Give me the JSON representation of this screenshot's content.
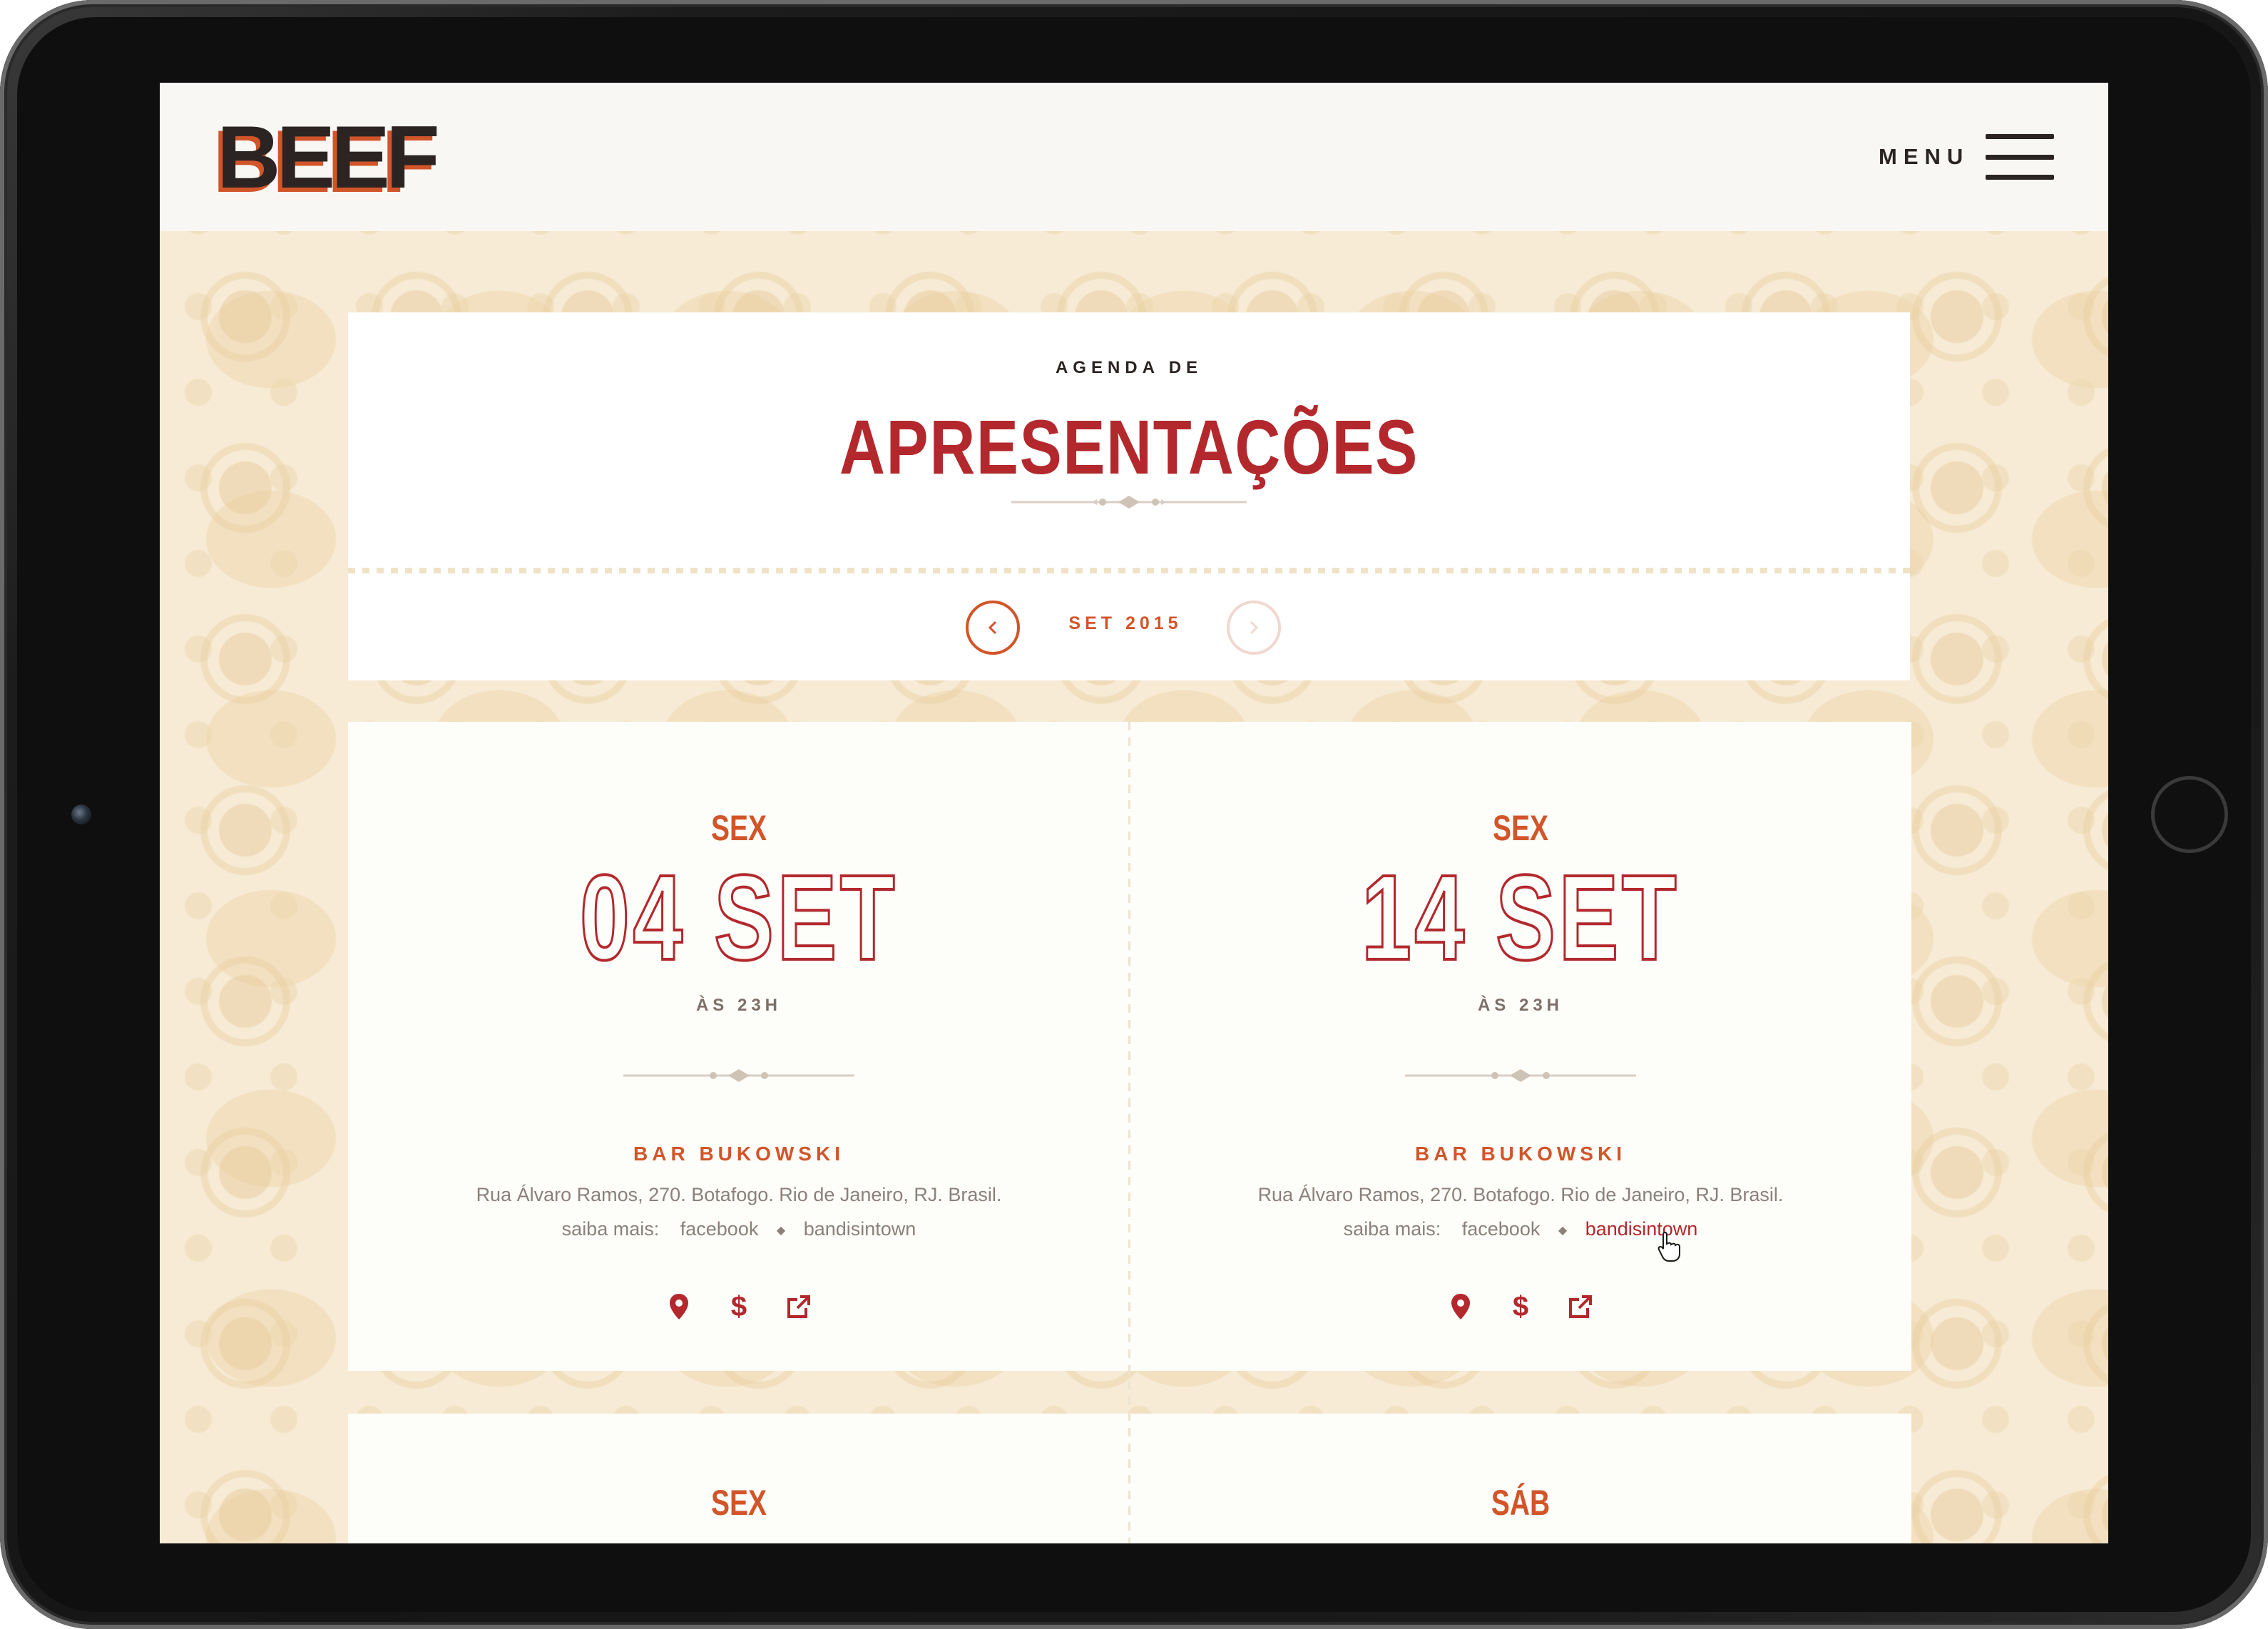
{
  "header": {
    "logo": "BEEF",
    "menu_label": "MENU"
  },
  "title": {
    "small": "AGENDA DE",
    "big": "APRESENTAÇÕES"
  },
  "month_nav": {
    "label": "SET 2015"
  },
  "events": [
    {
      "day": "SEX",
      "date": "04 SET",
      "time": "ÀS 23H",
      "venue": "BAR BUKOWSKI",
      "address": "Rua Álvaro Ramos, 270. Botafogo. Rio de Janeiro, RJ. Brasil.",
      "links_label": "saiba mais:",
      "link_facebook": "facebook",
      "link_bandsintown": "bandisintown"
    },
    {
      "day": "SEX",
      "date": "14 SET",
      "time": "ÀS 23H",
      "venue": "BAR BUKOWSKI",
      "address": "Rua Álvaro Ramos, 270. Botafogo. Rio de Janeiro, RJ. Brasil.",
      "links_label": "saiba mais:",
      "link_facebook": "facebook",
      "link_bandsintown": "bandisintown"
    },
    {
      "day": "SEX"
    },
    {
      "day": "SÁB"
    }
  ],
  "icons": {
    "location": "map-pin-icon",
    "price": "dollar-icon",
    "external": "external-link-icon"
  },
  "colors": {
    "brand_red": "#b3282d",
    "brand_orange": "#d2552a",
    "dark": "#2b2423",
    "muted_text": "#8c807a",
    "pattern_bg": "#f7ebd6"
  }
}
